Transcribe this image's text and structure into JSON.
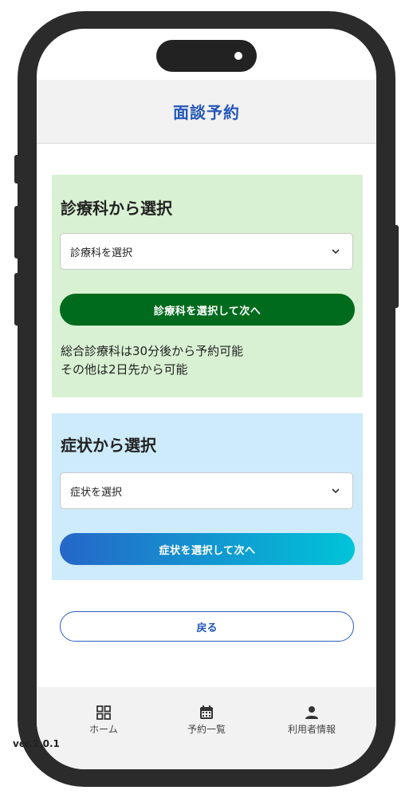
{
  "header": {
    "title": "面談予約"
  },
  "department_section": {
    "title": "診療科から選択",
    "select_value": "診療科を選択",
    "next_button": "診療科を選択して次へ",
    "note_line1": "総合診療科は30分後から予約可能",
    "note_line2": "その他は2日先から可能",
    "bg_color": "#d9f1d3",
    "button_color": "#006a1d"
  },
  "symptom_section": {
    "title": "症状から選択",
    "select_value": "症状を選択",
    "next_button": "症状を選択して次へ",
    "bg_color": "#cdebfa",
    "button_gradient": [
      "#2666c8",
      "#00c4d8"
    ]
  },
  "back_button": "戻る",
  "bottom_nav": {
    "items": [
      {
        "label": "ホーム",
        "icon": "grid-icon"
      },
      {
        "label": "予約一覧",
        "icon": "calendar-icon"
      },
      {
        "label": "利用者情報",
        "icon": "person-icon"
      }
    ],
    "version": "ver.1.0.1"
  },
  "accent_color": "#2356b8"
}
